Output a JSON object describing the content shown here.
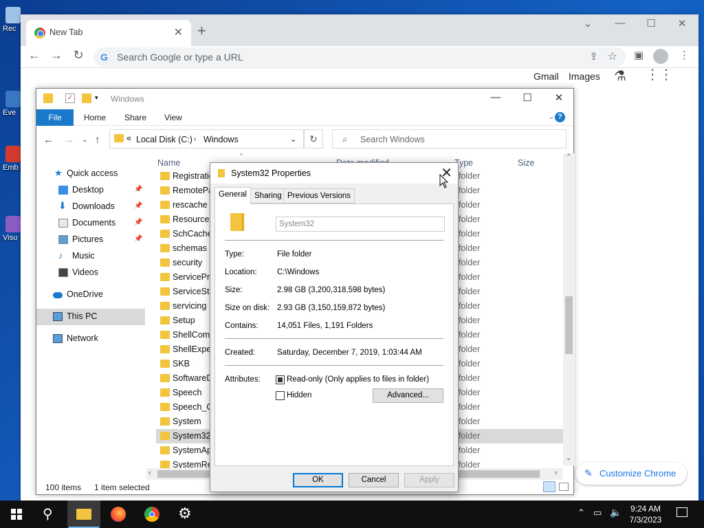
{
  "desktop": {
    "icons": [
      {
        "label": "Rec",
        "icon": "recycle-bin-icon",
        "color": "#9ec3e6"
      },
      {
        "label": "Eve",
        "icon": "shortcut-icon",
        "color": "#3b78c4"
      },
      {
        "label": "Emb De",
        "icon": "shortcut-icon",
        "color": "#d33a2f"
      },
      {
        "label": "Visu",
        "icon": "shortcut-icon",
        "color": "#8b5cc4"
      }
    ]
  },
  "chrome": {
    "tab_title": "New Tab",
    "tab_close": "✕",
    "new_tab": "+",
    "omnibox_placeholder": "Search Google or type a URL",
    "omnibox_google": "G",
    "gmail_label": "Gmail",
    "images_label": "Images",
    "customize_label": "Customize Chrome"
  },
  "explorer": {
    "title": "Windows",
    "ribbon": [
      "File",
      "Home",
      "Share",
      "View"
    ],
    "address": {
      "chevron": "«",
      "crumbs": [
        "Local Disk (C:)",
        "Windows"
      ]
    },
    "search_placeholder": "Search Windows",
    "columns": {
      "name": "Name",
      "date": "Date modified",
      "type": "Type",
      "size": "Size"
    },
    "nav": [
      {
        "label": "Quick access",
        "icon": "star-icon",
        "pinned": false
      },
      {
        "label": "Desktop",
        "icon": "desktop-icon",
        "pinned": true
      },
      {
        "label": "Downloads",
        "icon": "download-icon",
        "pinned": true
      },
      {
        "label": "Documents",
        "icon": "documents-icon",
        "pinned": true
      },
      {
        "label": "Pictures",
        "icon": "pictures-icon",
        "pinned": true
      },
      {
        "label": "Music",
        "icon": "music-icon",
        "pinned": false
      },
      {
        "label": "Videos",
        "icon": "videos-icon",
        "pinned": false
      },
      {
        "label": "OneDrive",
        "icon": "cloud-icon",
        "pinned": false
      },
      {
        "label": "This PC",
        "icon": "computer-icon",
        "pinned": false
      },
      {
        "label": "Network",
        "icon": "network-icon",
        "pinned": false
      }
    ],
    "files": [
      {
        "name": "Registration",
        "type": "folder"
      },
      {
        "name": "RemotePackages",
        "type": "folder"
      },
      {
        "name": "rescache",
        "type": "folder"
      },
      {
        "name": "Resources",
        "type": "folder"
      },
      {
        "name": "SchCache",
        "type": "folder"
      },
      {
        "name": "schemas",
        "type": "folder"
      },
      {
        "name": "security",
        "type": "folder"
      },
      {
        "name": "ServiceProfiles",
        "type": "folder"
      },
      {
        "name": "ServiceState",
        "type": "folder"
      },
      {
        "name": "servicing",
        "type": "folder"
      },
      {
        "name": "Setup",
        "type": "folder"
      },
      {
        "name": "ShellComponents",
        "type": "folder"
      },
      {
        "name": "ShellExperiences",
        "type": "folder"
      },
      {
        "name": "SKB",
        "type": "folder"
      },
      {
        "name": "SoftwareDistribution",
        "type": "folder"
      },
      {
        "name": "Speech",
        "type": "folder"
      },
      {
        "name": "Speech_OneCore",
        "type": "folder"
      },
      {
        "name": "System",
        "type": "folder"
      },
      {
        "name": "System32",
        "type": "folder"
      },
      {
        "name": "SystemApps",
        "type": "folder"
      },
      {
        "name": "SystemResources",
        "type": "folder"
      }
    ],
    "selected_file": "System32",
    "status_items": "100 items",
    "status_selected": "1 item selected"
  },
  "dialog": {
    "title": "System32 Properties",
    "tabs": [
      "General",
      "Sharing",
      "Previous Versions"
    ],
    "folder_name": "System32",
    "props": [
      {
        "label": "Type:",
        "value": "File folder"
      },
      {
        "label": "Location:",
        "value": "C:\\Windows"
      },
      {
        "label": "Size:",
        "value": "2.98 GB (3,200,318,598 bytes)"
      },
      {
        "label": "Size on disk:",
        "value": "2.93 GB (3,150,159,872 bytes)"
      },
      {
        "label": "Contains:",
        "value": "14,051 Files, 1,191 Folders"
      }
    ],
    "created_label": "Created:",
    "created_value": "Saturday, December 7, 2019, 1:03:44 AM",
    "attributes_label": "Attributes:",
    "readonly_label": "Read-only (Only applies to files in folder)",
    "hidden_label": "Hidden",
    "advanced_label": "Advanced...",
    "ok_label": "OK",
    "cancel_label": "Cancel",
    "apply_label": "Apply"
  },
  "taskbar": {
    "time": "9:24 AM",
    "date": "7/3/2023",
    "apps": [
      "start",
      "search",
      "file-explorer",
      "firefox",
      "chrome",
      "settings"
    ]
  }
}
